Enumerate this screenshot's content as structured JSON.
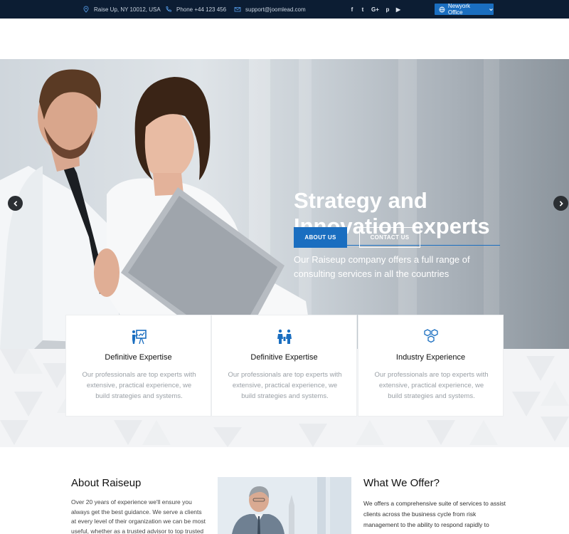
{
  "topbar": {
    "address": "Raise Up, NY 10012, USA",
    "phone": "Phone +44 123 456",
    "email": "support@joomlead.com",
    "social": [
      {
        "icon": "facebook-icon",
        "glyph": "f"
      },
      {
        "icon": "twitter-icon",
        "glyph": "t"
      },
      {
        "icon": "google-plus-icon",
        "glyph": "G+"
      },
      {
        "icon": "pinterest-icon",
        "glyph": "p"
      },
      {
        "icon": "youtube-icon",
        "glyph": "▶"
      }
    ],
    "office_label": "Newyork Office"
  },
  "hero": {
    "title": "Strategy and Innovation experts",
    "text": "Our Raiseup company offers a full range of consulting services in all the countries",
    "about_button": "ABOUT US",
    "contact_button": "CONTACT US",
    "prev_icon": "arrow-left-icon",
    "next_icon": "arrow-right-icon"
  },
  "features": [
    {
      "icon": "presentation-icon",
      "title": "Definitive Expertise",
      "text": "Our professionals are top experts with extensive, practical experience, we build strategies and systems."
    },
    {
      "icon": "team-icon",
      "title": "Definitive Expertise",
      "text": "Our professionals are top experts with extensive, practical experience, we build strategies and systems."
    },
    {
      "icon": "hexagons-icon",
      "title": "Industry Experience",
      "text": "Our professionals are top experts with extensive, practical experience, we build strategies and systems."
    }
  ],
  "about": {
    "title": "About Raiseup",
    "text": "Over 20 years of experience we'll ensure you always get the best guidance. We serve a clients at every level of their organization we can be most useful, whether as a trusted advisor to top trusted"
  },
  "offer": {
    "title": "What We Offer?",
    "text": "We offers a comprehensive suite of services to assist clients across the business cycle from risk management to the ability to respond rapidly to"
  },
  "colors": {
    "topbar_bg": "#0c1d33",
    "accent": "#1a6ec0",
    "pattern_bg": "#f3f4f6"
  }
}
